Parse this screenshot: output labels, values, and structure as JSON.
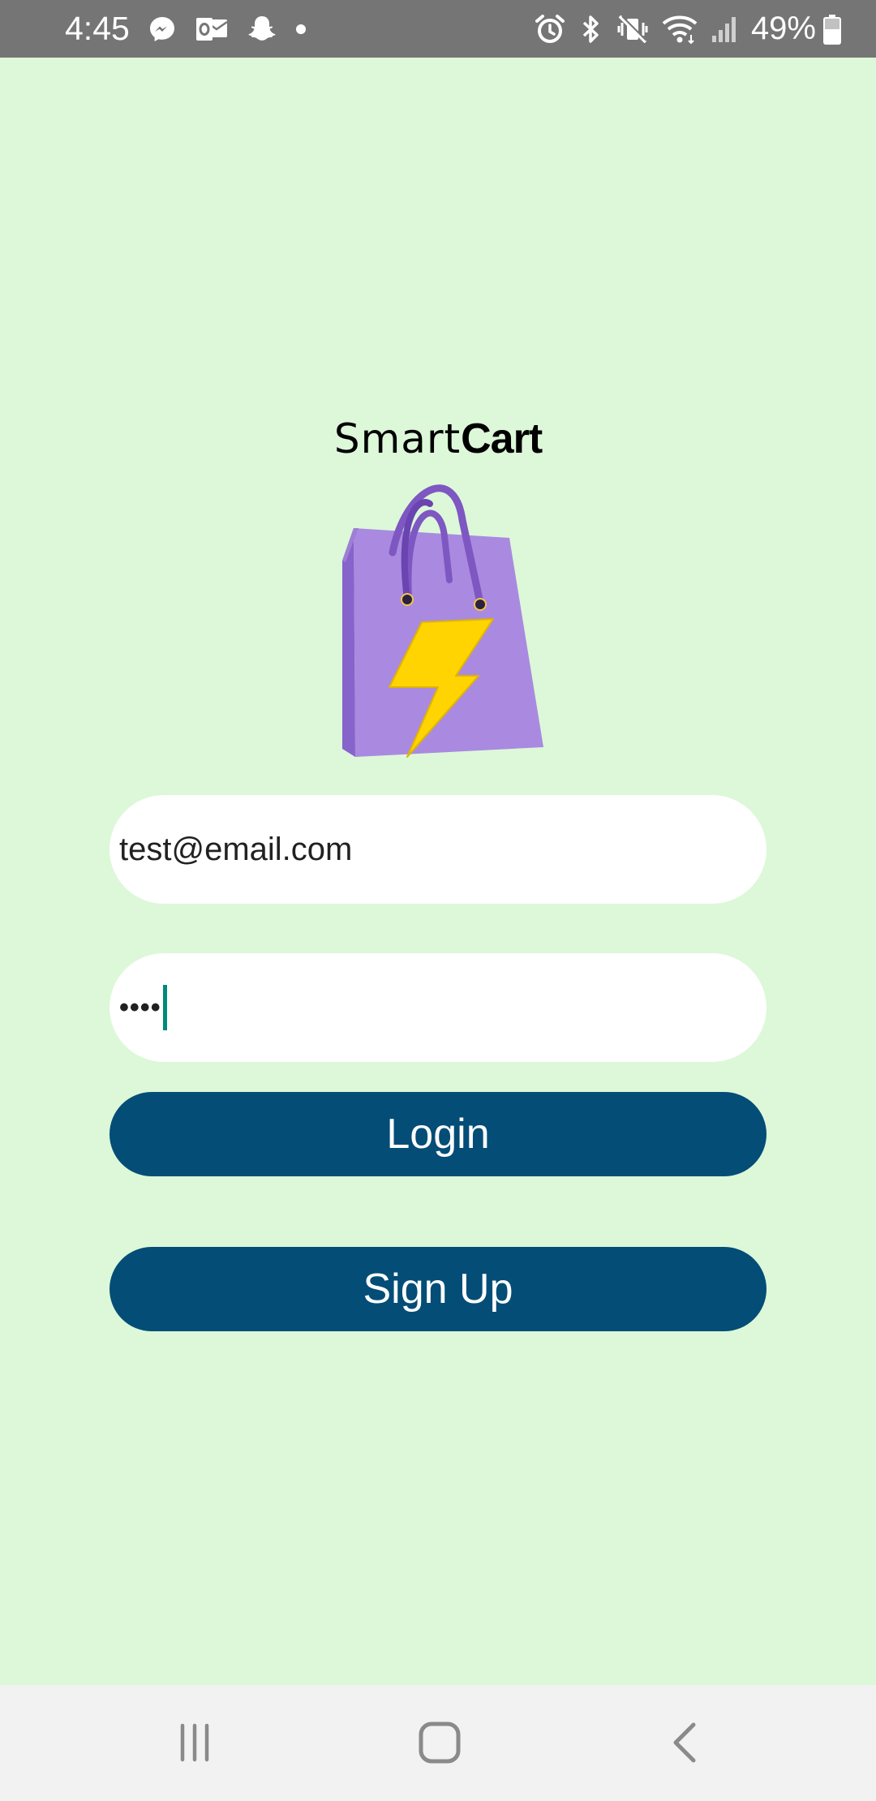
{
  "status_bar": {
    "time": "4:45",
    "battery": "49%",
    "left_icons": [
      "messenger-icon",
      "outlook-icon",
      "snapchat-icon",
      "notification-dot-icon"
    ],
    "right_icons": [
      "alarm-icon",
      "bluetooth-icon",
      "vibrate-mute-icon",
      "wifi-icon",
      "signal-icon",
      "battery-icon"
    ]
  },
  "logo": {
    "text_regular": "Smart",
    "text_bold": "Cart",
    "icon": "shopping-bag-lightning-icon"
  },
  "login_form": {
    "email_value": "test@email.com",
    "password_mask": "••••"
  },
  "buttons": {
    "login_label": "Login",
    "signup_label": "Sign Up"
  },
  "nav_bar": {
    "icons": [
      "recents-icon",
      "home-icon",
      "back-icon"
    ]
  },
  "colors": {
    "background": "#dcf8d8",
    "status_bar": "#757575",
    "button": "#034d77",
    "bag": "#a98ae0",
    "bolt": "#ffd400",
    "caret": "#00897b"
  }
}
